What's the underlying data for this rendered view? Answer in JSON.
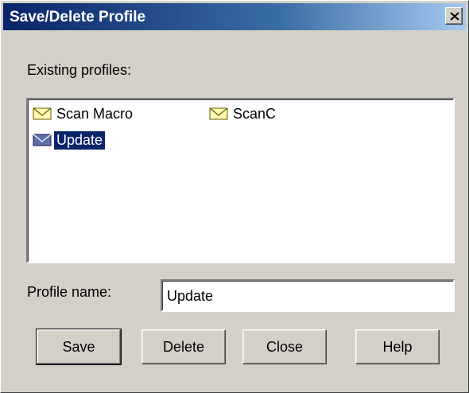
{
  "window": {
    "title": "Save/Delete Profile",
    "close_label": "X"
  },
  "existing_profiles_label": "Existing profiles:",
  "profiles": [
    {
      "name": "Scan Macro",
      "selected": false,
      "icon": "envelope-icon"
    },
    {
      "name": "ScanC",
      "selected": false,
      "icon": "envelope-icon"
    },
    {
      "name": "Update",
      "selected": true,
      "icon": "envelope-icon"
    }
  ],
  "profile_name": {
    "label": "Profile name:",
    "value": "Update"
  },
  "buttons": {
    "save": "Save",
    "delete": "Delete",
    "close": "Close",
    "help": "Help"
  },
  "colors": {
    "title_gradient_start": "#0a246a",
    "title_gradient_end": "#a6caf0",
    "selection": "#0a246a",
    "face": "#d4d0c8"
  }
}
